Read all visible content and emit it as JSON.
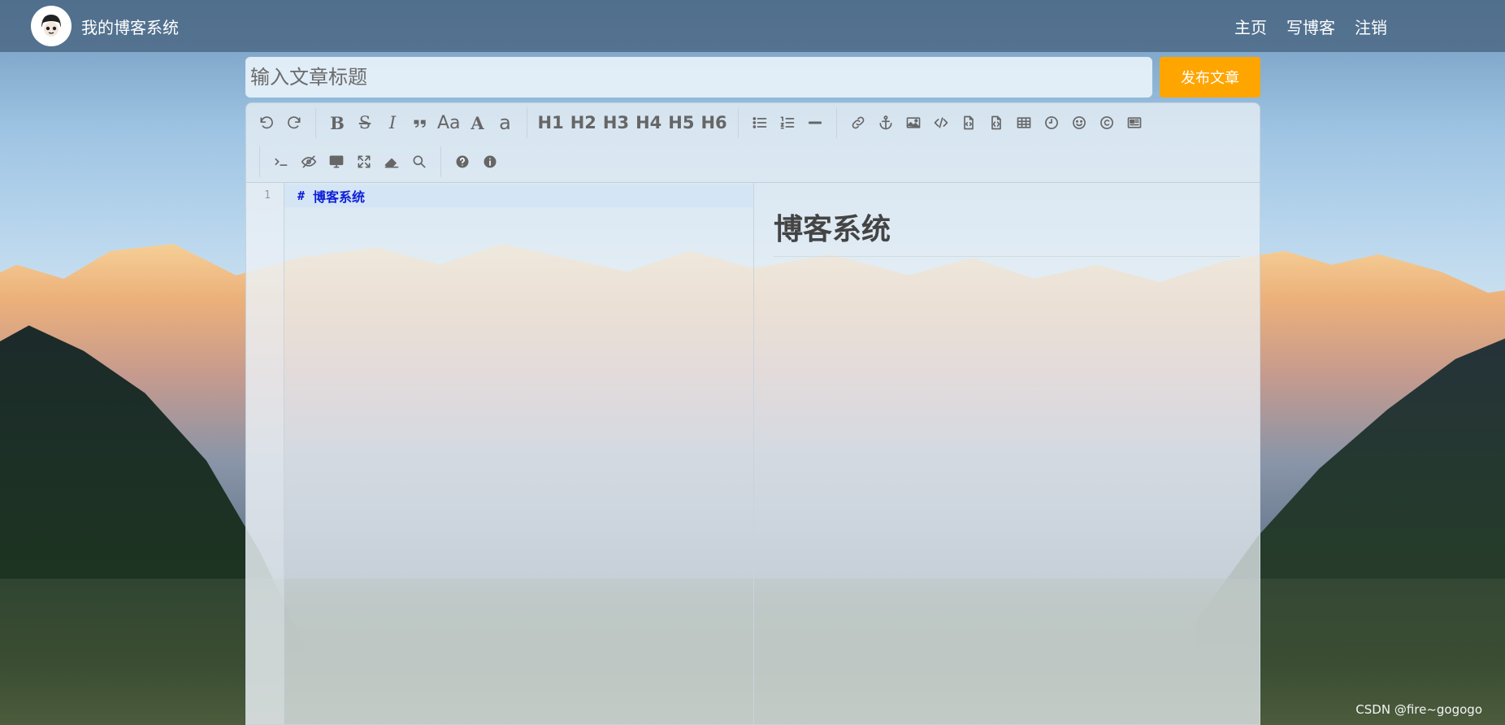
{
  "nav": {
    "brand": "我的博客系统",
    "links": [
      "主页",
      "写博客",
      "注销"
    ]
  },
  "title_input": {
    "placeholder": "输入文章标题",
    "value": ""
  },
  "publish_button": {
    "label": "发布文章",
    "color": "#ffa500"
  },
  "toolbar": {
    "headings": [
      "H1",
      "H2",
      "H3",
      "H4",
      "H5",
      "H6"
    ],
    "case_labels": [
      "Aa",
      "A",
      "a"
    ],
    "icons": [
      "undo-icon",
      "redo-icon",
      "bold-icon",
      "strikethrough-icon",
      "italic-icon",
      "quote-icon",
      "uppercase-icon",
      "ucwords-icon",
      "lowercase-icon",
      "h1",
      "h2",
      "h3",
      "h4",
      "h5",
      "h6",
      "list-ul-icon",
      "list-ol-icon",
      "hr-icon",
      "link-icon",
      "anchor-icon",
      "image-icon",
      "code-icon",
      "preformatted-code-icon",
      "code-block-icon",
      "table-icon",
      "datetime-icon",
      "emoji-icon",
      "html-entities-icon",
      "pagebreak-icon",
      "terminal-icon",
      "watch-toggle-icon",
      "preview-icon",
      "fullscreen-icon",
      "clear-icon",
      "search-icon",
      "help-icon",
      "info-icon"
    ]
  },
  "editor": {
    "line_numbers": [
      "1"
    ],
    "lines": [
      {
        "hash": "#",
        "text": "博客系统"
      }
    ]
  },
  "preview": {
    "heading": "博客系统"
  },
  "watermark": "CSDN @fire~gogogo",
  "colors": {
    "code_text": "#0f20d8",
    "nav_bg": "#486480",
    "publish": "#ffa500"
  }
}
